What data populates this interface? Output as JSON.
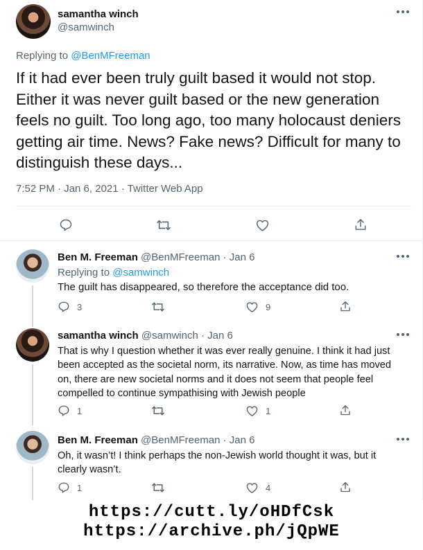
{
  "main_tweet": {
    "display_name": "samantha winch",
    "handle": "@samwinch",
    "replying_prefix": "Replying to",
    "replying_to": "@BenMFreeman",
    "text": "If it had ever been truly guilt based it would not stop. Either it was never guilt based or the new generation feels no guilt.  Too long ago, too many holocaust deniers getting air time.  News?  Fake news?  Difficult for many to distinguish these days...",
    "meta": "7:52 PM · Jan 6, 2021 · Twitter Web App"
  },
  "replies": [
    {
      "display_name": "Ben M. Freeman",
      "handle_date": "@BenMFreeman · Jan 6",
      "replying_prefix": "Replying to",
      "replying_to": "@samwinch",
      "text": "The guilt has disappeared, so therefore the acceptance did too.",
      "reply_count": "3",
      "retweet_count": "",
      "like_count": "9"
    },
    {
      "display_name": "samantha winch",
      "handle_date": "@samwinch · Jan 6",
      "text": "That is why I question whether it was ever really genuine.  I think it had just been accepted as the societal norm, its narrative.  Now, as time has moved on, there are new societal norms and it does not seem that people feel compelled to continue sympathising with Jewish people",
      "reply_count": "1",
      "retweet_count": "",
      "like_count": "1"
    },
    {
      "display_name": "Ben M. Freeman",
      "handle_date": "@BenMFreeman · Jan 6",
      "text": "Oh, it wasn’t! I think perhaps the non-Jewish world thought it was, but it clearly wasn’t.",
      "reply_count": "1",
      "retweet_count": "",
      "like_count": "4"
    }
  ],
  "urls": {
    "line1": "https://cutt.ly/oHDfCsk",
    "line2": "https://archive.ph/jQpWE"
  },
  "colors": {
    "link": "#1d9bf0",
    "muted": "#536471",
    "divider": "#e6ecf0"
  }
}
